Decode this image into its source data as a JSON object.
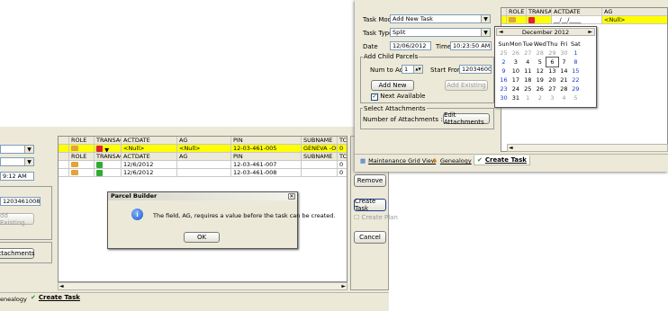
{
  "back_window": {
    "combo_partial_3": "9:12 AM",
    "start_from_value": "1203461008",
    "add_existing_label": "dd Existing",
    "attachments_label": "ttachments",
    "columns": [
      "ROLE",
      "TRANSACTI",
      "ACTDATE",
      "AG",
      "PIN",
      "SUBNAME",
      "TC"
    ],
    "highlight_row": {
      "actdate": "<Null>",
      "ag": "<Null>",
      "pin": "12-03-461-005",
      "subname": "GENEVA -ORIGINAL",
      "tc": "0"
    },
    "sub_header": {
      "role": "ROLE",
      "trans": "TRANSACTI",
      "actdate": "ACTDATE",
      "ag": "AG",
      "pin": "PIN",
      "subname": "SUBNAME",
      "tc": "TC"
    },
    "rows": [
      {
        "actdate": "12/6/2012",
        "pin": "12-03-461-007",
        "tc": "0"
      },
      {
        "actdate": "12/6/2012",
        "pin": "12-03-461-008",
        "tc": "0"
      }
    ],
    "right_buttons": {
      "remove": "Remove",
      "create_task": "Create Task",
      "create_plan": "Create Plan",
      "cancel": "Cancel"
    },
    "tabs": {
      "genealogy_partial": "enealogy",
      "create_task": "Create Task"
    }
  },
  "dialog": {
    "title": "Parcel Builder",
    "message": "The field, AG, requires a value before the task can be created.",
    "ok": "OK"
  },
  "front_window": {
    "task_mode_label": "Task Mode",
    "task_mode_value": "Add New Task",
    "task_type_label": "Task Type",
    "task_type_value": "Split",
    "date_label": "Date",
    "date_value": "12/06/2012",
    "time_label": "Time",
    "time_value": "10:23:50 AM",
    "child_group": "Add Child Parcels",
    "num_to_add_label": "Num to Add",
    "num_to_add_value": "1",
    "start_from_label": "Start From",
    "start_from_value": "1203460008",
    "add_new": "Add New",
    "add_existing": "Add Existing",
    "next_available": "Next Available",
    "attach_group": "Select Attachments",
    "attach_count": "Number of Attachments : (0)",
    "edit_attachments": "Edit Attachments",
    "columns": [
      "ROLE",
      "TRANSACTI",
      "ACTDATE",
      "AG"
    ],
    "highlight_row": {
      "actdate": "__/__/____",
      "ag": "<Null>"
    },
    "tabs": {
      "maintenance": "Maintenance Grid View",
      "genealogy": "Genealogy",
      "create_task": "Create Task"
    }
  },
  "calendar": {
    "month_title": "December 2012",
    "weekdays": [
      "Sun",
      "Mon",
      "Tue",
      "Wed",
      "Thu",
      "Fri",
      "Sat"
    ],
    "weeks": [
      [
        "25",
        "26",
        "27",
        "28",
        "29",
        "30",
        "1"
      ],
      [
        "2",
        "3",
        "4",
        "5",
        "6",
        "7",
        "8"
      ],
      [
        "9",
        "10",
        "11",
        "12",
        "13",
        "14",
        "15"
      ],
      [
        "16",
        "17",
        "18",
        "19",
        "20",
        "21",
        "22"
      ],
      [
        "23",
        "24",
        "25",
        "26",
        "27",
        "28",
        "29"
      ],
      [
        "30",
        "31",
        "1",
        "2",
        "3",
        "4",
        "5"
      ]
    ],
    "selected_day": "6",
    "colors": {
      "weekend": "#1a3cc8",
      "other_month": "#9a9a9a",
      "highlight": "#ffff00"
    }
  }
}
